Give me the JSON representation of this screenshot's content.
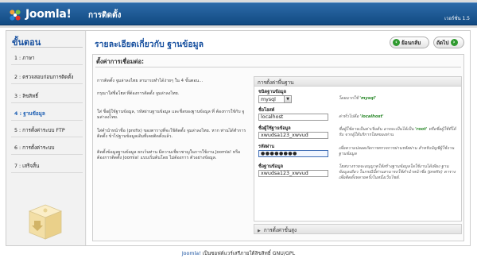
{
  "header": {
    "logo_text": "Joomla!",
    "install_title": "การติดตั้ง",
    "version": "เวอร์ชั่น 1.5"
  },
  "sidebar": {
    "title": "ขั้นตอน",
    "steps": [
      {
        "label": "1 : ภาษา",
        "active": false
      },
      {
        "label": "2 : ตรวจสอบก่อนการติดตั้ง",
        "active": false
      },
      {
        "label": "3 : ลิขสิทธิ์",
        "active": false
      },
      {
        "label": "4 : ฐานข้อมูล",
        "active": true
      },
      {
        "label": "5 : การตั้งค่าระบบ FTP",
        "active": false
      },
      {
        "label": "6 : การตั้งค่าระบบ",
        "active": false
      },
      {
        "label": "7 : เสร็จสิ้น",
        "active": false
      }
    ]
  },
  "main": {
    "title": "รายละเอียดเกี่ยวกับ ฐานข้อมูล",
    "back_label": "ย้อนกลับ",
    "next_label": "ถัดไป",
    "section_title": "ตั้งค่าการเชื่อมต่อ:",
    "descriptions": [
      "การติดตั้ง จูมล่าลงไทย สามารถทำได้ง่ายๆ ใน 4 ขั้นตอน...",
      "กรุณาใส่ชื่อโฮส ที่ต้องการติดตั้ง จูมล่าลงไทย.",
      "ใส่ ชื่อผู้ใช้ฐานข้อมูล, รหัสผ่านฐานข้อมูล และชื่อของฐานข้อมูล ที่ ต้องการใช้กับ จูมล่าลงไทย.",
      "ใส่คำนำหน้าชื่อ (prefix) ของตารางที่จะใช้ติดตั้ง จูมล่าลงไทย. หาก ท่านได้ทำการติดตั้ง ข้าไปฐานข้อมูลเดิมที่เคยติดตั้งแล้ว.",
      "ติดตั้งข้อมูลฐานข้อมูล ยกเว้นท่าน มีความเชี่ยวชาญในการใช้งาน Joomla! หรือต้องการติดตั้ง Joomla! แบบเริ่มต้นโดย ไม่ต้องการ ตัวอย่างข้อมูล."
    ],
    "basic": {
      "heading": "การตั้งค่าพื้นฐาน",
      "db_type_label": "ชนิดฐานข้อมูล",
      "db_type_value": "mysql",
      "db_type_hint_prefix": "โดยมากใช้",
      "db_type_hint_value": "'mysql'",
      "host_label": "ชื่อโฮสต์",
      "host_value": "localhost",
      "host_hint_prefix": "ค่าทั่วไปคือ",
      "host_hint_value": "'localhost'",
      "user_label": "ชื่อผู้ใช้ฐานข้อมูล",
      "user_value": "xwudsa123_xwvud",
      "user_hint_1": "ชื่อผู้ใช้อาจเป็นค่าเริ่มต้น อาจจะเป็นได้เป็น",
      "user_hint_value": "'root'",
      "user_hint_2": "หรือชื่อผู้ใช้ที่ได้รับ จากผู้ให้บริการโฮสของท่าน",
      "password_label": "รหัสผ่าน",
      "password_value": "●●●●●●●●",
      "password_hint": "เพื่อความปลอดภัยการตรวจการผ่านรหัสผ่าน สำหรับบัญชีผู้ใช้งานฐานข้อมูล",
      "dbname_label": "ชื่อฐานข้อมูล",
      "dbname_value": "xwudsa123_xwvud",
      "dbname_hint": "โฮสบางรายจะอนุญาตให้สร้างฐานข้อมูลใดใช้งานได้เพียง ฐานข้อมูลเดียว ในกรณีนี้ท่านสามารถใช้คำนำหน้าชื่อ (prefix) ตาราง เพื่อติดตั้งหลายครั้งในหนึ่งเว็บไซต์."
    },
    "advanced_label": "การตั้งค่าขั้นสูง"
  },
  "footer": {
    "link": "Joomla!",
    "text": "เป็นซอฟต์แวร์เสรีภายใต้ลิขสิทธิ์ GNU/GPL"
  },
  "colors": {
    "header_blue": "#1c5896",
    "title_blue": "#1a52a0",
    "nav_green": "#2f9a2f",
    "hint_green": "#2d8a2d"
  }
}
